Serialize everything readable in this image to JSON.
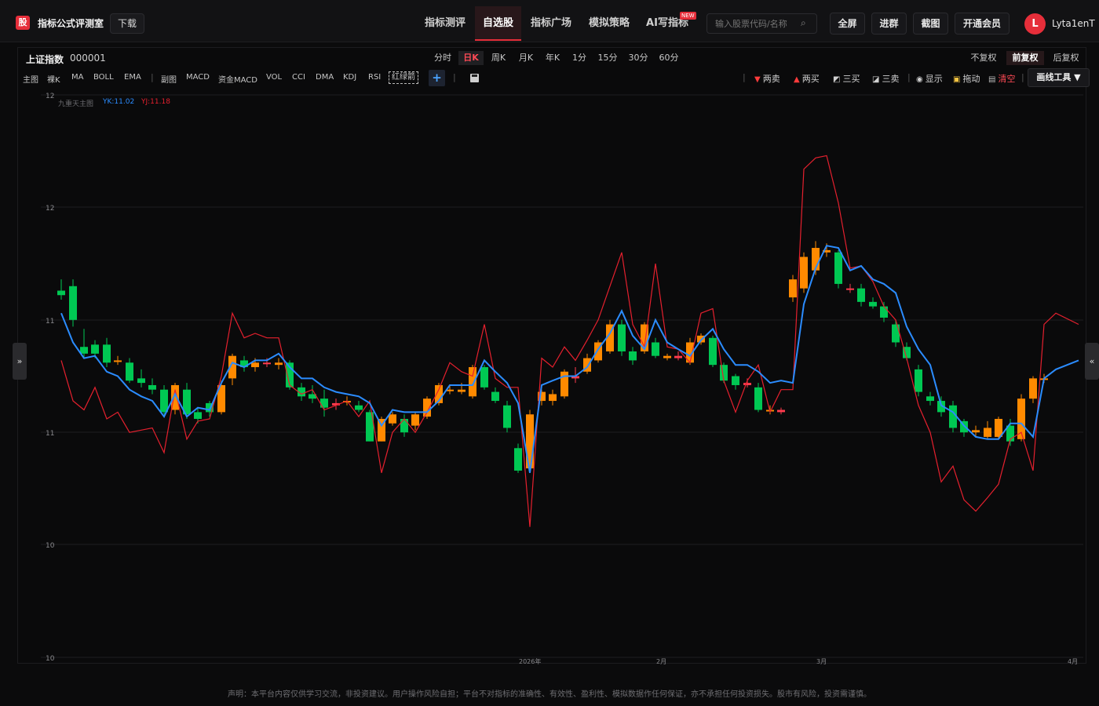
{
  "header": {
    "logo_text": "股",
    "brand": "指标公式评测室",
    "download": "下载",
    "nav": [
      "指标测评",
      "自选股",
      "指标广场",
      "模拟策略",
      "AI写指标"
    ],
    "nav_active": "自选股",
    "new_badge": "NEW",
    "search_placeholder": "输入股票代码/名称",
    "buttons": [
      "全屏",
      "进群",
      "截图",
      "开通会员"
    ],
    "avatar_letter": "L",
    "username": "Lyta1enT"
  },
  "symbol": {
    "name": "上证指数",
    "code": "000001"
  },
  "periods": [
    "分时",
    "日K",
    "周K",
    "月K",
    "年K",
    "1分",
    "15分",
    "30分",
    "60分"
  ],
  "period_active": "日K",
  "adjust": [
    "不复权",
    "前复权",
    "后复权"
  ],
  "adjust_active": "前复权",
  "indicators_main": [
    "主图",
    "裸K",
    "MA",
    "BOLL",
    "EMA"
  ],
  "indicators_sub": [
    "副图",
    "MACD",
    "资金MACD",
    "VOL",
    "CCI",
    "DMA",
    "KDJ",
    "RSI",
    "红绿箭"
  ],
  "add_label": "+",
  "tools": [
    {
      "icon": "down-triangle",
      "label": "两卖",
      "color": "#ff3b3b"
    },
    {
      "icon": "up-triangle",
      "label": "两买",
      "color": "#ff3b3b"
    },
    {
      "icon": "trend-up",
      "label": "三买",
      "color": "#ffffff"
    },
    {
      "icon": "trend-down",
      "label": "三卖",
      "color": "#ffffff"
    },
    {
      "icon": "eye",
      "label": "显示",
      "color": "#ffffff"
    },
    {
      "icon": "lock",
      "label": "拖动",
      "color": "#ffffff"
    },
    {
      "icon": "trash",
      "label": "清空",
      "color": "#ff4a55"
    }
  ],
  "draw_tools": "画线工具 ▼",
  "side_left": "»",
  "side_right": "«",
  "legend": {
    "name": "九重天主图",
    "yk": "YK:11.02",
    "yj": "YJ:11.18",
    "name_color": "#6a6a6e",
    "yk_color": "#2b8cff",
    "yj_color": "#e5202e"
  },
  "disclaimer": "声明：本平台内容仅供学习交流，非投资建议。用户操作风险自担；平台不对指标的准确性、有效性、盈利性、模拟数据作任何保证，亦不承担任何投资损失。股市有风险，投资需谨慎。",
  "chart_data": {
    "type": "candlestick",
    "y_ticks": [
      "12",
      "12",
      "11",
      "11",
      "10",
      "10"
    ],
    "x_ticks": [
      "2026年",
      "2月",
      "3月",
      "4月"
    ],
    "colors": {
      "up": "#ff8a00",
      "down": "#00c853",
      "flat": "#ff3b4e",
      "yk": "#2b8cff",
      "yj": "#e5202e"
    },
    "ylim": [
      10.0,
      12.5
    ],
    "candles": [
      {
        "o": 11.63,
        "c": 11.61,
        "h": 11.68,
        "l": 11.59
      },
      {
        "o": 11.65,
        "c": 11.5,
        "h": 11.68,
        "l": 11.47
      },
      {
        "o": 11.38,
        "c": 11.35,
        "h": 11.46,
        "l": 11.33
      },
      {
        "o": 11.39,
        "c": 11.35,
        "h": 11.41,
        "l": 11.33
      },
      {
        "o": 11.39,
        "c": 11.31,
        "h": 11.42,
        "l": 11.29
      },
      {
        "o": 11.32,
        "c": 11.32,
        "h": 11.34,
        "l": 11.3
      },
      {
        "o": 11.31,
        "c": 11.23,
        "h": 11.33,
        "l": 11.22
      },
      {
        "o": 11.24,
        "c": 11.22,
        "h": 11.28,
        "l": 11.2
      },
      {
        "o": 11.21,
        "c": 11.19,
        "h": 11.24,
        "l": 11.17
      },
      {
        "o": 11.19,
        "c": 11.09,
        "h": 11.21,
        "l": 11.08
      },
      {
        "o": 11.1,
        "c": 11.21,
        "h": 11.22,
        "l": 11.08
      },
      {
        "o": 11.19,
        "c": 11.08,
        "h": 11.22,
        "l": 11.06
      },
      {
        "o": 11.09,
        "c": 11.06,
        "h": 11.11,
        "l": 11.04
      },
      {
        "o": 11.13,
        "c": 11.09,
        "h": 11.14,
        "l": 11.07
      },
      {
        "o": 11.09,
        "c": 11.21,
        "h": 11.23,
        "l": 11.08
      },
      {
        "o": 11.24,
        "c": 11.34,
        "h": 11.35,
        "l": 11.21
      },
      {
        "o": 11.32,
        "c": 11.29,
        "h": 11.34,
        "l": 11.27
      },
      {
        "o": 11.29,
        "c": 11.31,
        "h": 11.33,
        "l": 11.27
      },
      {
        "o": 11.31,
        "c": 11.31,
        "h": 11.33,
        "l": 11.29
      },
      {
        "o": 11.3,
        "c": 11.31,
        "h": 11.33,
        "l": 11.28
      },
      {
        "o": 11.31,
        "c": 11.2,
        "h": 11.32,
        "l": 11.19
      },
      {
        "o": 11.2,
        "c": 11.16,
        "h": 11.22,
        "l": 11.14
      },
      {
        "o": 11.17,
        "c": 11.15,
        "h": 11.21,
        "l": 11.13
      },
      {
        "o": 11.15,
        "c": 11.11,
        "h": 11.19,
        "l": 11.07
      },
      {
        "o": 11.13,
        "c": 11.12,
        "h": 11.15,
        "l": 11.1
      },
      {
        "o": 11.14,
        "c": 11.14,
        "h": 11.16,
        "l": 11.12
      },
      {
        "o": 11.12,
        "c": 11.1,
        "h": 11.14,
        "l": 11.09
      },
      {
        "o": 11.09,
        "c": 10.96,
        "h": 11.1,
        "l": 10.96
      },
      {
        "o": 10.96,
        "c": 11.06,
        "h": 11.07,
        "l": 10.96
      },
      {
        "o": 11.04,
        "c": 11.08,
        "h": 11.09,
        "l": 11.03
      },
      {
        "o": 11.06,
        "c": 11.0,
        "h": 11.08,
        "l": 10.98
      },
      {
        "o": 11.03,
        "c": 11.08,
        "h": 11.09,
        "l": 11.01
      },
      {
        "o": 11.07,
        "c": 11.15,
        "h": 11.16,
        "l": 11.06
      },
      {
        "o": 11.13,
        "c": 11.21,
        "h": 11.22,
        "l": 11.12
      },
      {
        "o": 11.19,
        "c": 11.19,
        "h": 11.21,
        "l": 11.17
      },
      {
        "o": 11.18,
        "c": 11.19,
        "h": 11.22,
        "l": 11.17
      },
      {
        "o": 11.16,
        "c": 11.29,
        "h": 11.3,
        "l": 11.15
      },
      {
        "o": 11.29,
        "c": 11.2,
        "h": 11.3,
        "l": 11.19
      },
      {
        "o": 11.18,
        "c": 11.14,
        "h": 11.2,
        "l": 11.13
      },
      {
        "o": 11.12,
        "c": 11.02,
        "h": 11.14,
        "l": 11.0
      },
      {
        "o": 10.93,
        "c": 10.83,
        "h": 10.95,
        "l": 10.82
      },
      {
        "o": 10.84,
        "c": 11.08,
        "h": 11.1,
        "l": 10.83
      },
      {
        "o": 11.14,
        "c": 11.18,
        "h": 11.19,
        "l": 11.12
      },
      {
        "o": 11.14,
        "c": 11.17,
        "h": 11.19,
        "l": 11.12
      },
      {
        "o": 11.16,
        "c": 11.27,
        "h": 11.28,
        "l": 11.15
      },
      {
        "o": 11.24,
        "c": 11.25,
        "h": 11.29,
        "l": 11.22
      },
      {
        "o": 11.27,
        "c": 11.33,
        "h": 11.35,
        "l": 11.26
      },
      {
        "o": 11.32,
        "c": 11.4,
        "h": 11.41,
        "l": 11.31
      },
      {
        "o": 11.36,
        "c": 11.48,
        "h": 11.5,
        "l": 11.35
      },
      {
        "o": 11.48,
        "c": 11.36,
        "h": 11.5,
        "l": 11.34
      },
      {
        "o": 11.36,
        "c": 11.32,
        "h": 11.38,
        "l": 11.3
      },
      {
        "o": 11.36,
        "c": 11.48,
        "h": 11.49,
        "l": 11.35
      },
      {
        "o": 11.4,
        "c": 11.34,
        "h": 11.42,
        "l": 11.33
      },
      {
        "o": 11.33,
        "c": 11.34,
        "h": 11.35,
        "l": 11.32
      },
      {
        "o": 11.33,
        "c": 11.34,
        "h": 11.36,
        "l": 11.32
      },
      {
        "o": 11.31,
        "c": 11.4,
        "h": 11.42,
        "l": 11.3
      },
      {
        "o": 11.4,
        "c": 11.43,
        "h": 11.44,
        "l": 11.39
      },
      {
        "o": 11.42,
        "c": 11.3,
        "h": 11.43,
        "l": 11.29
      },
      {
        "o": 11.3,
        "c": 11.23,
        "h": 11.31,
        "l": 11.22
      },
      {
        "o": 11.25,
        "c": 11.21,
        "h": 11.26,
        "l": 11.19
      },
      {
        "o": 11.21,
        "c": 11.22,
        "h": 11.24,
        "l": 11.2
      },
      {
        "o": 11.2,
        "c": 11.1,
        "h": 11.22,
        "l": 11.09
      },
      {
        "o": 11.1,
        "c": 11.1,
        "h": 11.12,
        "l": 11.08
      },
      {
        "o": 11.09,
        "c": 11.1,
        "h": 11.11,
        "l": 11.08
      },
      {
        "o": 11.6,
        "c": 11.68,
        "h": 11.7,
        "l": 11.58
      },
      {
        "o": 11.64,
        "c": 11.78,
        "h": 11.8,
        "l": 11.62
      },
      {
        "o": 11.72,
        "c": 11.82,
        "h": 11.85,
        "l": 11.7
      },
      {
        "o": 11.81,
        "c": 11.8,
        "h": 11.84,
        "l": 11.78
      },
      {
        "o": 11.8,
        "c": 11.66,
        "h": 11.81,
        "l": 11.64
      },
      {
        "o": 11.64,
        "c": 11.64,
        "h": 11.66,
        "l": 11.62
      },
      {
        "o": 11.64,
        "c": 11.58,
        "h": 11.66,
        "l": 11.56
      },
      {
        "o": 11.58,
        "c": 11.56,
        "h": 11.6,
        "l": 11.55
      },
      {
        "o": 11.56,
        "c": 11.51,
        "h": 11.58,
        "l": 11.49
      },
      {
        "o": 11.48,
        "c": 11.4,
        "h": 11.5,
        "l": 11.38
      },
      {
        "o": 11.38,
        "c": 11.33,
        "h": 11.4,
        "l": 11.32
      },
      {
        "o": 11.28,
        "c": 11.18,
        "h": 11.3,
        "l": 11.16
      },
      {
        "o": 11.16,
        "c": 11.14,
        "h": 11.18,
        "l": 11.12
      },
      {
        "o": 11.14,
        "c": 11.09,
        "h": 11.16,
        "l": 11.07
      },
      {
        "o": 11.12,
        "c": 11.02,
        "h": 11.14,
        "l": 11.0
      },
      {
        "o": 11.05,
        "c": 11.0,
        "h": 11.06,
        "l": 10.98
      },
      {
        "o": 11.01,
        "c": 11.0,
        "h": 11.03,
        "l": 10.98
      },
      {
        "o": 10.98,
        "c": 11.02,
        "h": 11.05,
        "l": 10.97
      },
      {
        "o": 10.98,
        "c": 11.06,
        "h": 11.07,
        "l": 10.97
      },
      {
        "o": 11.03,
        "c": 10.96,
        "h": 11.06,
        "l": 10.94
      },
      {
        "o": 10.97,
        "c": 11.15,
        "h": 11.17,
        "l": 10.96
      },
      {
        "o": 11.15,
        "c": 11.24,
        "h": 11.25,
        "l": 11.13
      },
      {
        "o": 11.24,
        "c": 11.24,
        "h": 11.26,
        "l": 11.22
      }
    ],
    "candle_x": [
      78,
      93,
      107,
      121,
      136,
      150,
      165,
      180,
      194,
      209,
      223,
      238,
      252,
      267,
      282,
      296,
      311,
      325,
      340,
      355,
      369,
      384,
      398,
      413,
      428,
      442,
      457,
      471,
      486,
      500,
      515,
      529,
      544,
      559,
      573,
      588,
      602,
      617,
      631,
      646,
      660,
      675,
      690,
      704,
      719,
      733,
      748,
      762,
      777,
      792,
      806,
      821,
      835,
      850,
      864,
      879,
      893,
      908,
      922,
      937,
      952,
      966,
      981,
      995,
      1010,
      1024,
      1039,
      1053,
      1068,
      1083,
      1097,
      1112,
      1126,
      1141,
      1155,
      1170,
      1185,
      1199,
      1214,
      1228,
      1243,
      1258,
      1272,
      1287,
      1301,
      1316,
      1330,
      1345,
      1374
    ],
    "yk": [
      [
        78,
        11.53
      ],
      [
        93,
        11.4
      ],
      [
        107,
        11.33
      ],
      [
        121,
        11.34
      ],
      [
        136,
        11.27
      ],
      [
        150,
        11.25
      ],
      [
        165,
        11.19
      ],
      [
        180,
        11.16
      ],
      [
        194,
        11.14
      ],
      [
        209,
        11.07
      ],
      [
        223,
        11.17
      ],
      [
        238,
        11.07
      ],
      [
        252,
        11.11
      ],
      [
        267,
        11.1
      ],
      [
        282,
        11.22
      ],
      [
        296,
        11.31
      ],
      [
        311,
        11.29
      ],
      [
        325,
        11.32
      ],
      [
        340,
        11.32
      ],
      [
        355,
        11.35
      ],
      [
        369,
        11.29
      ],
      [
        384,
        11.24
      ],
      [
        398,
        11.24
      ],
      [
        413,
        11.2
      ],
      [
        428,
        11.18
      ],
      [
        442,
        11.17
      ],
      [
        457,
        11.16
      ],
      [
        471,
        11.13
      ],
      [
        486,
        11.03
      ],
      [
        500,
        11.1
      ],
      [
        515,
        11.09
      ],
      [
        529,
        11.09
      ],
      [
        544,
        11.09
      ],
      [
        559,
        11.14
      ],
      [
        573,
        11.21
      ],
      [
        588,
        11.21
      ],
      [
        602,
        11.21
      ],
      [
        617,
        11.32
      ],
      [
        631,
        11.27
      ],
      [
        646,
        11.22
      ],
      [
        660,
        11.13
      ],
      [
        675,
        10.82
      ],
      [
        690,
        11.21
      ],
      [
        704,
        11.23
      ],
      [
        719,
        11.25
      ],
      [
        733,
        11.25
      ],
      [
        748,
        11.29
      ],
      [
        762,
        11.37
      ],
      [
        777,
        11.44
      ],
      [
        792,
        11.54
      ],
      [
        806,
        11.43
      ],
      [
        821,
        11.37
      ],
      [
        835,
        11.5
      ],
      [
        850,
        11.4
      ],
      [
        864,
        11.37
      ],
      [
        879,
        11.34
      ],
      [
        893,
        11.41
      ],
      [
        908,
        11.46
      ],
      [
        922,
        11.37
      ],
      [
        937,
        11.3
      ],
      [
        952,
        11.3
      ],
      [
        966,
        11.27
      ],
      [
        981,
        11.22
      ],
      [
        995,
        11.23
      ],
      [
        1010,
        11.22
      ],
      [
        1024,
        11.57
      ],
      [
        1039,
        11.73
      ],
      [
        1053,
        11.83
      ],
      [
        1068,
        11.82
      ],
      [
        1083,
        11.72
      ],
      [
        1097,
        11.74
      ],
      [
        1112,
        11.68
      ],
      [
        1126,
        11.66
      ],
      [
        1141,
        11.62
      ],
      [
        1155,
        11.47
      ],
      [
        1170,
        11.37
      ],
      [
        1185,
        11.3
      ],
      [
        1199,
        11.12
      ],
      [
        1214,
        11.09
      ],
      [
        1228,
        11.03
      ],
      [
        1243,
        10.98
      ],
      [
        1258,
        10.97
      ],
      [
        1272,
        10.97
      ],
      [
        1287,
        11.04
      ],
      [
        1301,
        11.04
      ],
      [
        1316,
        10.98
      ],
      [
        1330,
        11.24
      ],
      [
        1345,
        11.28
      ],
      [
        1374,
        11.32
      ]
    ],
    "yj": [
      [
        78,
        11.32
      ],
      [
        93,
        11.14
      ],
      [
        107,
        11.1
      ],
      [
        121,
        11.2
      ],
      [
        136,
        11.06
      ],
      [
        150,
        11.09
      ],
      [
        165,
        11.0
      ],
      [
        180,
        11.01
      ],
      [
        194,
        11.02
      ],
      [
        209,
        10.91
      ],
      [
        223,
        11.19
      ],
      [
        238,
        10.97
      ],
      [
        252,
        11.05
      ],
      [
        267,
        11.06
      ],
      [
        282,
        11.25
      ],
      [
        296,
        11.53
      ],
      [
        311,
        11.42
      ],
      [
        325,
        11.44
      ],
      [
        340,
        11.42
      ],
      [
        355,
        11.42
      ],
      [
        369,
        11.21
      ],
      [
        384,
        11.17
      ],
      [
        398,
        11.19
      ],
      [
        413,
        11.1
      ],
      [
        428,
        11.12
      ],
      [
        442,
        11.14
      ],
      [
        457,
        11.07
      ],
      [
        471,
        11.14
      ],
      [
        486,
        10.82
      ],
      [
        500,
        11.0
      ],
      [
        515,
        11.06
      ],
      [
        529,
        11.0
      ],
      [
        544,
        11.09
      ],
      [
        559,
        11.19
      ],
      [
        573,
        11.31
      ],
      [
        588,
        11.27
      ],
      [
        602,
        11.25
      ],
      [
        617,
        11.48
      ],
      [
        631,
        11.24
      ],
      [
        646,
        11.2
      ],
      [
        660,
        11.2
      ],
      [
        675,
        10.58
      ],
      [
        690,
        11.33
      ],
      [
        704,
        11.29
      ],
      [
        719,
        11.38
      ],
      [
        733,
        11.32
      ],
      [
        748,
        11.41
      ],
      [
        762,
        11.5
      ],
      [
        777,
        11.65
      ],
      [
        792,
        11.8
      ],
      [
        806,
        11.48
      ],
      [
        821,
        11.38
      ],
      [
        835,
        11.75
      ],
      [
        850,
        11.38
      ],
      [
        864,
        11.37
      ],
      [
        879,
        11.31
      ],
      [
        893,
        11.53
      ],
      [
        908,
        11.55
      ],
      [
        922,
        11.23
      ],
      [
        937,
        11.09
      ],
      [
        952,
        11.23
      ],
      [
        966,
        11.3
      ],
      [
        981,
        11.09
      ],
      [
        995,
        11.19
      ],
      [
        1010,
        11.19
      ],
      [
        1024,
        12.17
      ],
      [
        1039,
        12.22
      ],
      [
        1053,
        12.23
      ],
      [
        1068,
        12.02
      ],
      [
        1083,
        11.73
      ],
      [
        1097,
        11.74
      ],
      [
        1112,
        11.67
      ],
      [
        1126,
        11.56
      ],
      [
        1141,
        11.5
      ],
      [
        1155,
        11.33
      ],
      [
        1170,
        11.12
      ],
      [
        1185,
        11.0
      ],
      [
        1199,
        10.78
      ],
      [
        1214,
        10.85
      ],
      [
        1228,
        10.7
      ],
      [
        1243,
        10.65
      ],
      [
        1258,
        10.71
      ],
      [
        1272,
        10.77
      ],
      [
        1287,
        10.97
      ],
      [
        1301,
        11.0
      ],
      [
        1316,
        10.83
      ],
      [
        1330,
        11.48
      ],
      [
        1345,
        11.53
      ],
      [
        1374,
        11.48
      ]
    ]
  }
}
